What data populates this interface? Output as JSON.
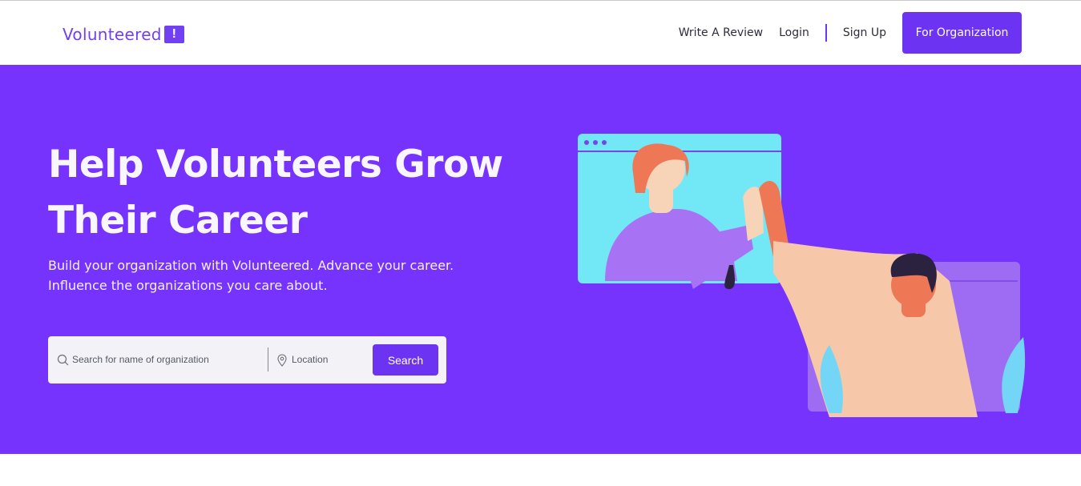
{
  "brand": {
    "name": "Volunteered",
    "mark": "!",
    "accent": "#7040f2"
  },
  "nav": {
    "write_review": "Write A Review",
    "login": "Login",
    "sign_up": "Sign Up",
    "for_org": "For Organization"
  },
  "hero": {
    "bg": "#7533fd",
    "title_line1": "Help Volunteers Grow",
    "title_line2": "Their Career",
    "subtitle_line1": "Build your organization with Volunteered. Advance your career.",
    "subtitle_line2": "Influence the organizations you care about."
  },
  "search": {
    "name_placeholder": "Search for name of organization",
    "location_placeholder": "Location",
    "button": "Search",
    "name_icon": "search-icon",
    "location_icon": "map-pin-icon"
  },
  "illustration": {
    "icon": "high-five-illustration"
  }
}
